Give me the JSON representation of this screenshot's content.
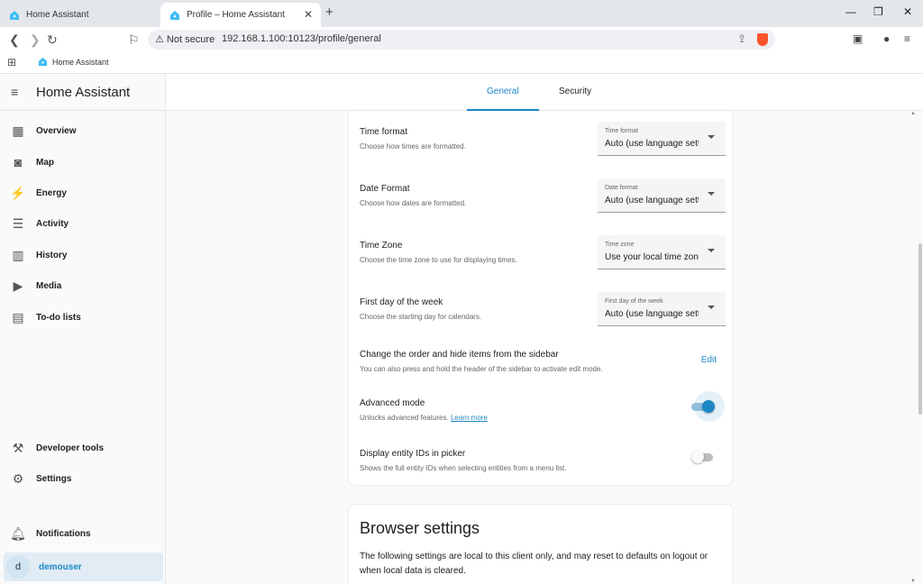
{
  "browser": {
    "tabs": [
      {
        "title": "Home Assistant",
        "icon": "home-assistant-icon"
      },
      {
        "title": "Profile – Home Assistant",
        "icon": "home-assistant-icon",
        "active": true
      }
    ],
    "address": {
      "security_label": "Not secure",
      "url": "192.168.1.100:10123/profile/general"
    },
    "bookmarks": [
      {
        "label": "Home Assistant",
        "icon": "home-assistant-icon"
      }
    ]
  },
  "sidebar": {
    "title": "Home Assistant",
    "items": [
      {
        "label": "Overview",
        "icon": "dashboard-icon"
      },
      {
        "label": "Map",
        "icon": "map-icon"
      },
      {
        "label": "Energy",
        "icon": "lightning-icon"
      },
      {
        "label": "Activity",
        "icon": "list-icon"
      },
      {
        "label": "History",
        "icon": "chart-icon"
      },
      {
        "label": "Media",
        "icon": "play-icon"
      },
      {
        "label": "To-do lists",
        "icon": "clipboard-icon"
      }
    ],
    "bottom_items": [
      {
        "label": "Developer tools",
        "icon": "hammer-icon"
      },
      {
        "label": "Settings",
        "icon": "gear-icon"
      }
    ],
    "notifications": {
      "label": "Notifications",
      "icon": "bell-icon"
    },
    "user": {
      "label": "demouser",
      "avatar_letter": "d"
    }
  },
  "header": {
    "tabs": [
      {
        "label": "General",
        "active": true
      },
      {
        "label": "Security",
        "active": false
      }
    ]
  },
  "settings": {
    "time_format": {
      "title": "Time format",
      "subtitle": "Choose how times are formatted.",
      "select_label": "Time format",
      "select_value": "Auto (use language setting)"
    },
    "date_format": {
      "title": "Date Format",
      "subtitle": "Choose how dates are formatted.",
      "select_label": "Date format",
      "select_value": "Auto (use language setting)"
    },
    "time_zone": {
      "title": "Time Zone",
      "subtitle": "Choose the time zone to use for displaying times.",
      "select_label": "Time zone",
      "select_value": "Use your local time zone"
    },
    "first_day": {
      "title": "First day of the week",
      "subtitle": "Choose the starting day for calendars.",
      "select_label": "First day of the week",
      "select_value": "Auto (use language setting)"
    },
    "sidebar_order": {
      "title": "Change the order and hide items from the sidebar",
      "subtitle": "You can also press and hold the header of the sidebar to activate edit mode.",
      "button_label": "Edit"
    },
    "advanced_mode": {
      "title": "Advanced mode",
      "subtitle": "Unlocks advanced features.",
      "link_label": "Learn more",
      "enabled": true
    },
    "entity_ids": {
      "title": "Display entity IDs in picker",
      "subtitle": "Shows the full entity IDs when selecting entities from a menu list.",
      "enabled": false
    }
  },
  "browser_settings": {
    "title": "Browser settings",
    "description": "The following settings are local to this client only, and may reset to defaults on logout or when local data is cleared."
  },
  "colors": {
    "accent": "#1e88c7",
    "brave": "#fb542b"
  }
}
